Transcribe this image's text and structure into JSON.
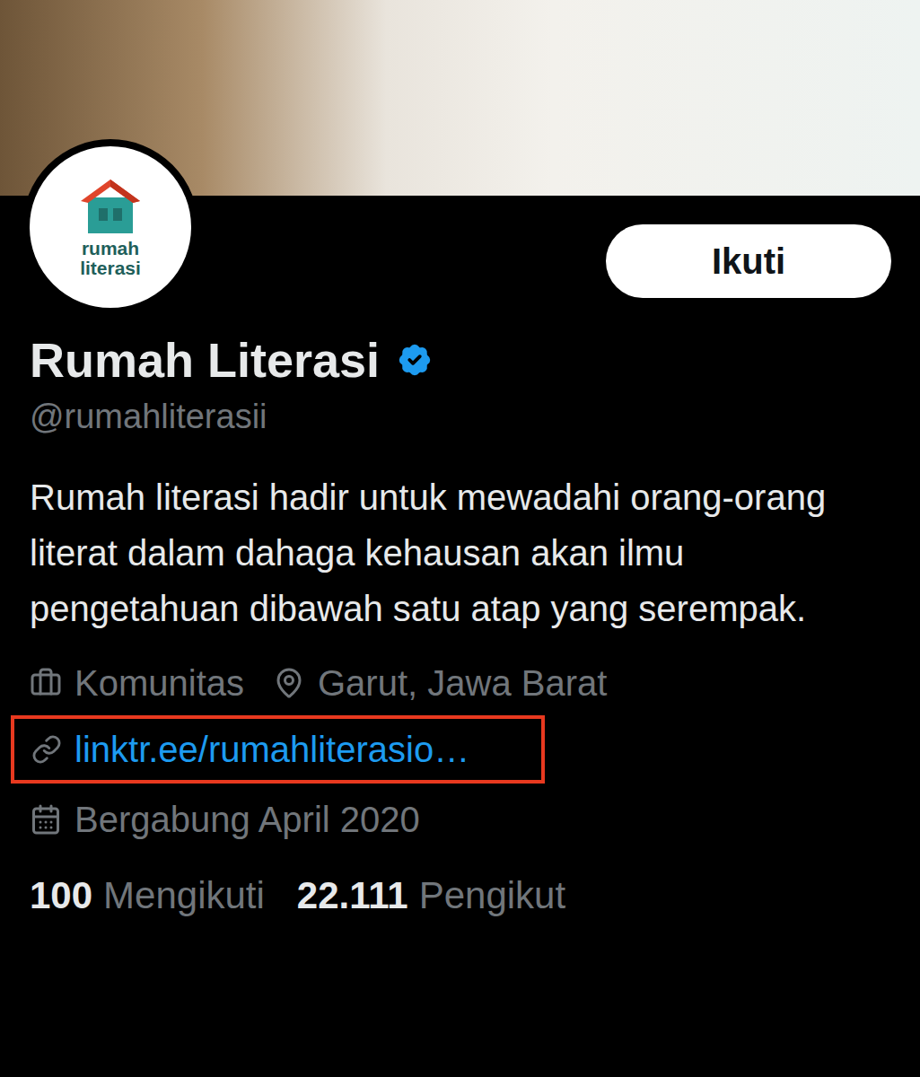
{
  "profile": {
    "avatar_text": [
      "rumah",
      "literasi"
    ],
    "name": "Rumah Literasi",
    "verified": true,
    "handle": "@rumahliterasii",
    "bio": "Rumah literasi hadir untuk mewadahi orang-orang literat dalam dahaga kehausan akan ilmu pengetahuan dibawah satu atap yang serempak.",
    "category": "Komunitas",
    "location": "Garut, Jawa Barat",
    "link": {
      "text": "linktr.ee/rumahliterasio…",
      "highlighted": true
    },
    "joined": "Bergabung April 2020"
  },
  "follow_button": {
    "label": "Ikuti"
  },
  "stats": [
    {
      "count": "100",
      "label": "Mengikuti"
    },
    {
      "count": "22.111",
      "label": "Pengikut"
    }
  ]
}
